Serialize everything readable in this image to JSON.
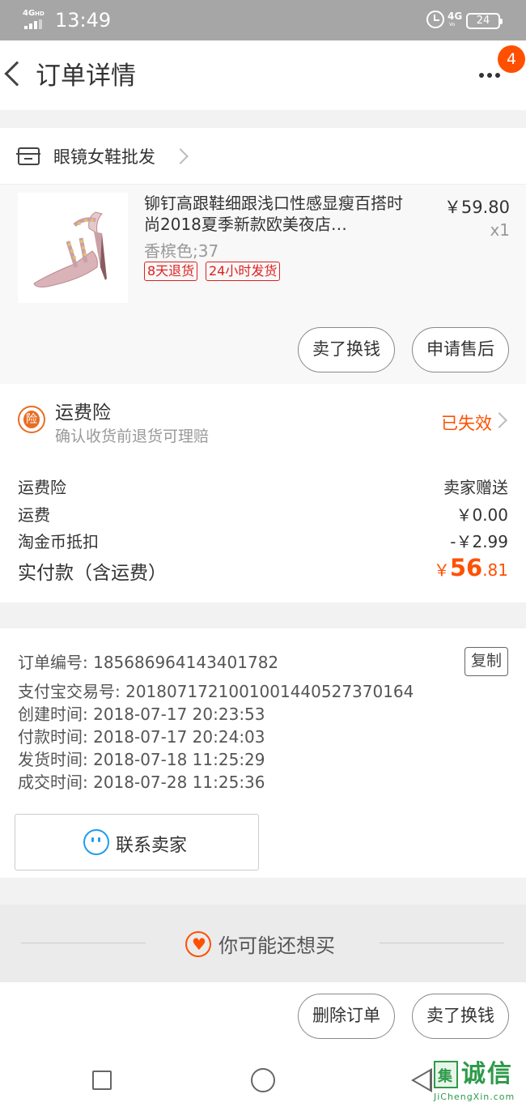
{
  "status_bar": {
    "network": "4G",
    "network_sup": "HD",
    "time": "13:49",
    "net_right": "4G",
    "net_right_sub": "Vo",
    "battery": "24"
  },
  "header": {
    "title": "订单详情",
    "badge": "4"
  },
  "store": {
    "name": "眼镜女鞋批发"
  },
  "item": {
    "title": "铆钉高跟鞋细跟浅口性感显瘦百搭时尚2018夏季新款欧美夜店…",
    "price": "￥59.80",
    "qty": "x1",
    "sku": "香槟色;37",
    "tags": [
      "8天退货",
      "24小时发货"
    ],
    "buttons": [
      "卖了换钱",
      "申请售后"
    ]
  },
  "insurance": {
    "icon_text": "险",
    "title": "运费险",
    "subtitle": "确认收货前退货可理赔",
    "status": "已失效"
  },
  "fees": [
    {
      "label": "运费险",
      "value": "卖家赠送"
    },
    {
      "label": "运费",
      "value": "￥0.00"
    },
    {
      "label": "淘金币抵扣",
      "value": "-￥2.99"
    }
  ],
  "total": {
    "label": "实付款（含运费）",
    "currency": "￥",
    "integer": "56",
    "decimal": ".81"
  },
  "order_info": {
    "order_no": "订单编号: 1856869641434​01782",
    "alipay_no": "支付宝交易号: 2018071721001001440527370164",
    "created": "创建时间: 2018-07-17 20:23:53",
    "paid": "付款时间: 2018-07-17 20:24:03",
    "shipped": "发货时间: 2018-07-18 11:25:29",
    "completed": "成交时间: 2018-07-28 11:25:36",
    "copy_label": "复制",
    "contact_label": "联系卖家"
  },
  "recommend": {
    "label": "你可能还想买"
  },
  "bottom_actions": [
    "删除订单",
    "卖了换钱"
  ],
  "watermark": {
    "box_char": "集",
    "text": "诚信",
    "sub": "JiChengXin.com"
  },
  "colors": {
    "accent": "#ff5000",
    "tag_red": "#e02020",
    "insurance_orange": "#e86d23",
    "chat_blue": "#1f9cf0"
  },
  "icons": [
    "back-icon",
    "more-icon",
    "shop-icon",
    "chevron-right-icon",
    "insurance-icon",
    "chat-icon",
    "heart-icon"
  ]
}
